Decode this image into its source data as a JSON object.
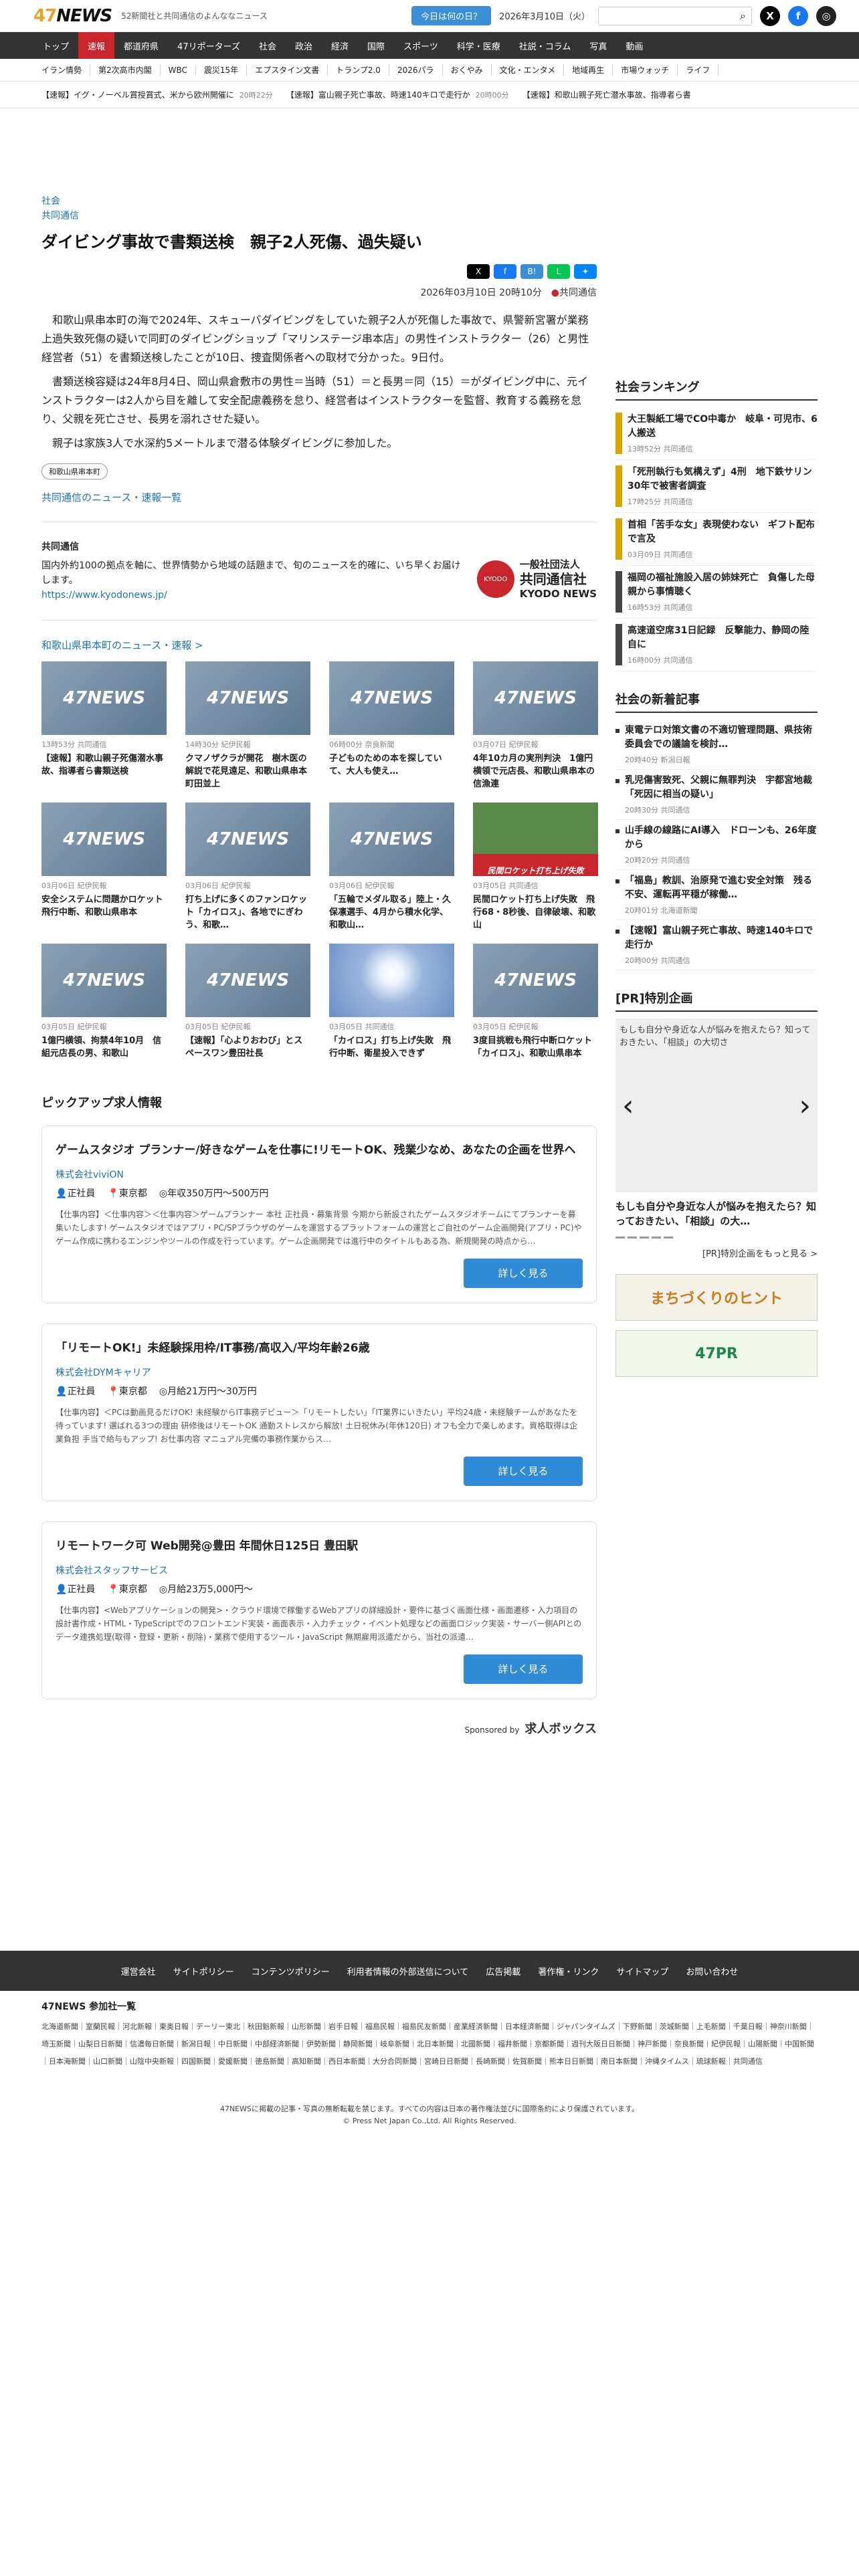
{
  "header": {
    "logo": "47NEWS",
    "tagline": "52新聞社と共同通信のよんななニュース",
    "today_button": "今日は何の日？",
    "date": "2026年3月10日（火）"
  },
  "nav": [
    "トップ",
    "速報",
    "都道府県",
    "47リポーターズ",
    "社会",
    "政治",
    "経済",
    "国際",
    "スポーツ",
    "科学・医療",
    "社説・コラム",
    "写真",
    "動画"
  ],
  "subnav": [
    "イラン情勢",
    "第2次高市内閣",
    "WBC",
    "震災15年",
    "エプスタイン文書",
    "トランプ2.0",
    "2026パラ",
    "おくやみ",
    "文化・エンタメ",
    "地域再生",
    "市場ウォッチ",
    "ライフ"
  ],
  "ticker": [
    {
      "text": "【速報】イグ・ノーベル賞授賞式、米から欧州開催に",
      "time": "20時22分"
    },
    {
      "text": "【速報】富山親子死亡事故、時速140キロで走行か",
      "time": "20時00分"
    },
    {
      "text": "【速報】和歌山親子死亡潜水事故、指導者ら書",
      "time": ""
    }
  ],
  "article": {
    "category": "社会",
    "source": "共同通信",
    "title": "ダイビング事故で書類送検　親子2人死傷、過失疑い",
    "date": "2026年03月10日 20時10分",
    "agency": "共同通信",
    "paragraphs": [
      "和歌山県串本町の海で2024年、スキューバダイビングをしていた親子2人が死傷した事故で、県警新宮署が業務上過失致死傷の疑いで同町のダイビングショップ「マリンステージ串本店」の男性インストラクター（26）と男性経営者（51）を書類送検したことが10日、捜査関係者への取材で分かった。9日付。",
      "書類送検容疑は24年8月4日、岡山県倉敷市の男性＝当時（51）＝と長男＝同（15）＝がダイビング中に、元インストラクターは2人から目を離して安全配慮義務を怠り、経営者はインストラクターを監督、教育する義務を怠り、父親を死亡させ、長男を溺れさせた疑い。",
      "親子は家族3人で水深約5メートルまで潜る体験ダイビングに参加した。"
    ],
    "tag": "和歌山県串本町",
    "more_link": "共同通信のニュース・速報一覧"
  },
  "kyodo": {
    "name": "共同通信",
    "desc": "国内外約100の拠点を軸に、世界情勢から地域の話題まで、旬のニュースを的確に、いち早くお届けします。",
    "url": "https://www.kyodonews.jp/",
    "logo_small": "一般社団法人",
    "logo_name": "共同通信社",
    "logo_en": "KYODO NEWS",
    "logo_circle": "KYODO"
  },
  "area_link": "和歌山県串本町のニュース・速報 >",
  "cards": [
    {
      "thumb": "47NEWS",
      "meta": "13時53分 共同通信",
      "title": "【速報】和歌山親子死傷潜水事故、指導者ら書類送検"
    },
    {
      "thumb": "47NEWS",
      "meta": "14時30分 紀伊民報",
      "title": "クマノザクラが開花　樹木医の解説で花見遠足、和歌山県串本町田並上"
    },
    {
      "thumb": "47NEWS",
      "meta": "06時00分 奈良新聞",
      "title": "子どものための本を探していて、大人も使え…"
    },
    {
      "thumb": "47NEWS",
      "meta": "03月07日 紀伊民報",
      "title": "4年10カ月の実刑判決　1億円横領で元店長、和歌山県串本の信漁連"
    },
    {
      "thumb": "47NEWS",
      "meta": "03月06日 紀伊民報",
      "title": "安全システムに問題かロケット飛行中断、和歌山県串本"
    },
    {
      "thumb": "47NEWS",
      "meta": "03月06日 紀伊民報",
      "title": "打ち上げに多くのファンロケット「カイロス」、各地でにぎわう、和歌…"
    },
    {
      "thumb": "47NEWS",
      "meta": "03月06日 紀伊民報",
      "title": "「五輪でメダル取る」陸上・久保凛選手、4月から積水化学、和歌山…"
    },
    {
      "thumb": "民間ロケット打ち上げ失敗",
      "meta": "03月05日 共同通信",
      "title": "民間ロケット打ち上げ失敗　飛行68・8秒後、自律破壊、和歌山"
    },
    {
      "thumb": "47NEWS",
      "meta": "03月05日 紀伊民報",
      "title": "1億円横領、拘禁4年10月　信組元店長の男、和歌山"
    },
    {
      "thumb": "47NEWS",
      "meta": "03月05日 紀伊民報",
      "title": "【速報】「心よりおわび」とスペースワン豊田社長"
    },
    {
      "thumb": "",
      "meta": "03月05日 共同通信",
      "title": "「カイロス」打ち上げ失敗　飛行中断、衛星投入できず"
    },
    {
      "thumb": "47NEWS",
      "meta": "03月05日 紀伊民報",
      "title": "3度目挑戦も飛行中断ロケット「カイロス」、和歌山県串本"
    }
  ],
  "jobs_title": "ピックアップ求人情報",
  "jobs": [
    {
      "title": "ゲームスタジオ プランナー/好きなゲームを仕事に!リモートOK、残業少なめ、あなたの企画を世界へ",
      "company": "株式会社viviON",
      "type": "正社員",
      "place": "東京都",
      "salary": "年収350万円～500万円",
      "desc": "【仕事内容】＜仕事内容＞＜仕事内容＞ゲームプランナー 本社 正社員・募集背景 今期から新設されたゲームスタジオチームにてプランナーを募集いたします! ゲームスタジオではアプリ・PC/SPブラウザのゲームを運営するプラットフォームの運営とご自社のゲーム企画開発(アプリ・PC)やゲーム作成に携わるエンジンやツールの作成を行っています。ゲーム企画開発では進行中のタイトルもある為、新規開発の時点から…",
      "btn": "詳しく見る"
    },
    {
      "title": "「リモートOK!」未経験採用枠/IT事務/高収入/平均年齢26歳",
      "company": "株式会社DYMキャリア",
      "type": "正社員",
      "place": "東京都",
      "salary": "月給21万円～30万円",
      "desc": "【仕事内容】＜PCは動画見るだけOK! 未経験からIT事務デビュー＞「リモートしたい」「IT業界にいきたい」平均24歳・未経験チームがあなたを待っています! 選ばれる3つの理由 研修後はリモートOK 通勤ストレスから解放! 土日祝休み(年休120日) オフも全力で楽しめます。資格取得は企業負担 手当で給与もアップ! お仕事内容 マニュアル完備の事務作業からス…",
      "btn": "詳しく見る"
    },
    {
      "title": "リモートワーク可 Web開発@豊田 年間休日125日 豊田駅",
      "company": "株式会社スタッフサービス",
      "type": "正社員",
      "place": "東京都",
      "salary": "月給23万5,000円～",
      "desc": "【仕事内容】<Webアプリケーションの開発>・クラウド環境で稼働するWebアプリの詳細設計・要件に基づく画面仕様・画面遷移・入力項目の設計書作成・HTML・TypeScriptでのフロントエンド実装・画面表示・入力チェック・イベント処理などの画面ロジック実装・サーバー側APIとのデータ連携処理(取得・登録・更新・削除)・業務で使用するツール・JavaScript 無期雇用派遣だから、当社の派遣…",
      "btn": "詳しく見る"
    }
  ],
  "sponsor": {
    "label": "Sponsored by",
    "name": "求人ボックス"
  },
  "ranking_title": "社会ランキング",
  "ranking": [
    {
      "title": "大王製紙工場でCO中毒か　岐阜・可児市、6人搬送",
      "meta": "13時52分 共同通信"
    },
    {
      "title": "「死刑執行も気構えず」4刑　地下鉄サリン30年で被害者調査",
      "meta": "17時25分 共同通信"
    },
    {
      "title": "首相「苦手な女」表現使わない　ギフト配布で言及",
      "meta": "03月09日 共同通信"
    },
    {
      "title": "福岡の福祉施設入居の姉妹死亡　負傷した母親から事情聴く",
      "meta": "16時53分 共同通信"
    },
    {
      "title": "高速道空席31日記録　反撃能力、静岡の陸自に",
      "meta": "16時00分 共同通信"
    }
  ],
  "new_title": "社会の新着記事",
  "new_articles": [
    {
      "title": "東電テロ対策文書の不適切管理問題、県技術委員会での議論を検討…",
      "meta": "20時40分 新潟日報"
    },
    {
      "title": "乳児傷害致死、父親に無罪判決　宇都宮地裁「死因に相当の疑い」",
      "meta": "20時30分 共同通信"
    },
    {
      "title": "山手線の線路にAI導入　ドローンも、26年度から",
      "meta": "20時20分 共同通信"
    },
    {
      "title": "「福島」教訓、治原発で進む安全対策　残る不安、運転再平穏が稼働…",
      "meta": "20時01分 北海道新聞"
    },
    {
      "title": "【速報】富山親子死亡事故、時速140キロで走行か",
      "meta": "20時00分 共同通信"
    }
  ],
  "pr_title": "[PR]特別企画",
  "pr_text": "もしも自分や身近な人が悩みを抱えたら？知っておきたい、「相談」の大…",
  "pr_img_alt": "もしも自分や身近な人が悩みを抱えたら？知っておきたい、「相談」の大切さ",
  "pr_link": "[PR]特別企画をもっと見る >",
  "banners": [
    "まちづくりのヒント",
    "47PR"
  ],
  "footer_links": [
    "運営会社",
    "サイトポリシー",
    "コンテンツポリシー",
    "利用者情報の外部送信について",
    "広告掲載",
    "著作権・リンク",
    "サイトマップ",
    "お問い合わせ"
  ],
  "partners_title": "47NEWS 参加社一覧",
  "partners": "北海道新聞｜室蘭民報｜河北新報｜東奥日報｜デーリー東北｜秋田魁新報｜山形新聞｜岩手日報｜福島民報｜福島民友新聞｜産業経済新聞｜日本経済新聞｜ジャパンタイムズ｜下野新聞｜茨城新聞｜上毛新聞｜千葉日報｜神奈川新聞｜埼玉新聞｜山梨日日新聞｜信濃毎日新聞｜新潟日報｜中日新聞｜中部経済新聞｜伊勢新聞｜静岡新聞｜岐阜新聞｜北日本新聞｜北國新聞｜福井新聞｜京都新聞｜週刊大阪日日新聞｜神戸新聞｜奈良新聞｜紀伊民報｜山陽新聞｜中国新聞｜日本海新聞｜山口新聞｜山陰中央新報｜四国新聞｜愛媛新聞｜徳島新聞｜高知新聞｜西日本新聞｜大分合同新聞｜宮崎日日新聞｜長崎新聞｜佐賀新聞｜熊本日日新聞｜南日本新聞｜沖縄タイムス｜琉球新報｜共同通信",
  "copyright": [
    "47NEWSに掲載の記事・写真の無断転載を禁じます。すべての内容は日本の著作権法並びに国際条約により保護されています。",
    "© Press Net Japan Co.,Ltd. All Rights Reserved."
  ]
}
